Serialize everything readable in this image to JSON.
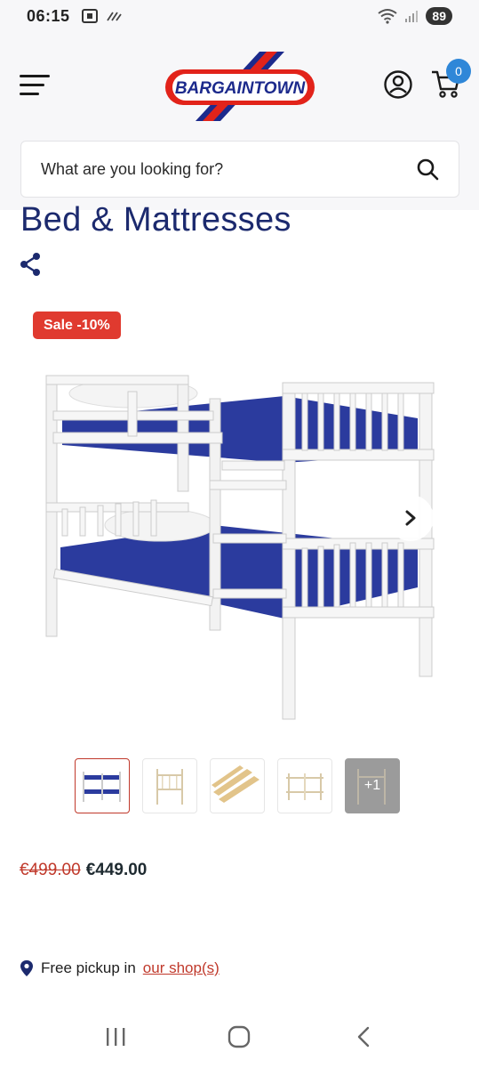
{
  "status_bar": {
    "time": "06:15",
    "battery": "89"
  },
  "header": {
    "logo_text": "BARGAINTOWN",
    "cart_count": "0",
    "colors": {
      "logo_red": "#e2231a",
      "logo_blue": "#1c2a8c",
      "badge_blue": "#2f87d8"
    }
  },
  "search": {
    "placeholder": "What are you looking for?"
  },
  "product": {
    "title": "Bed & Mattresses",
    "sale_badge": "Sale -10%",
    "thumbnails": [
      {
        "name": "bunk-bed-blue-mattress"
      },
      {
        "name": "bunk-bed-front"
      },
      {
        "name": "slats"
      },
      {
        "name": "bunk-bed-side"
      },
      {
        "name": "more",
        "label": "+1"
      }
    ],
    "price_old": "€499.00",
    "price_new": "€449.00"
  },
  "pickup": {
    "text": "Free pickup in",
    "link": "our shop(s)"
  },
  "icons": [
    "menu-icon",
    "account-icon",
    "cart-icon",
    "search-icon",
    "share-icon",
    "chevron-right-icon",
    "location-pin-icon",
    "recent-apps-icon",
    "home-icon",
    "back-icon"
  ]
}
